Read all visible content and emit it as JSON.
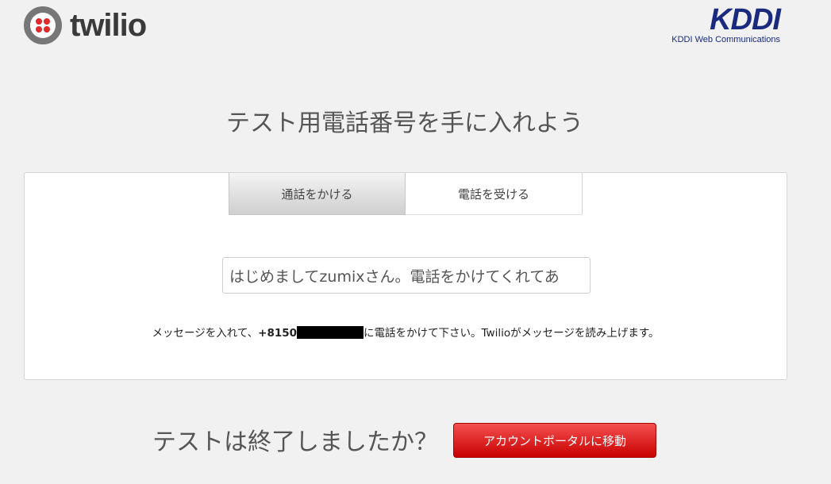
{
  "header": {
    "twilio_logo_text": "twilio",
    "kddi_logo_text": "KDDI",
    "kddi_subtitle": "KDDI Web Communications"
  },
  "page_title": "テスト用電話番号を手に入れよう",
  "tabs": [
    {
      "label": "通話をかける",
      "active": false
    },
    {
      "label": "電話を受ける",
      "active": true
    }
  ],
  "message_input": {
    "value": "はじめましてzumixさん。電話をかけてくれてあ"
  },
  "instructions": {
    "prefix": "メッセージを入れて、",
    "phone_prefix": "+8150",
    "suffix": "に電話をかけて下さい。Twilioがメッセージを読み上げます。"
  },
  "footer": {
    "question": "テストは終了しましたか？",
    "portal_button_label": "アカウントポータルに移動"
  },
  "colors": {
    "background": "#f1f1f1",
    "accent_red": "#e02a2a",
    "kddi_blue": "#1a2a7e"
  }
}
